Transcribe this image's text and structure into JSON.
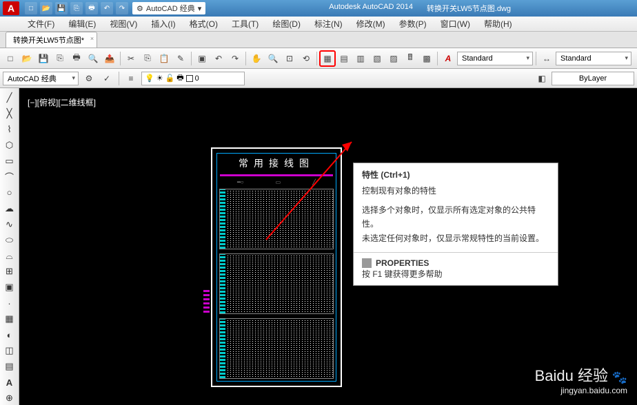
{
  "titlebar": {
    "logo": "A",
    "workspace": "AutoCAD 经典",
    "app_name": "Autodesk AutoCAD 2014",
    "doc_name": "转换开关LW5节点图.dwg"
  },
  "menubar": {
    "file": "文件(F)",
    "edit": "编辑(E)",
    "view": "视图(V)",
    "insert": "插入(I)",
    "format": "格式(O)",
    "tools": "工具(T)",
    "draw": "绘图(D)",
    "dimension": "标注(N)",
    "modify": "修改(M)",
    "param": "参数(P)",
    "window": "窗口(W)",
    "help": "帮助(H)"
  },
  "tab": {
    "name": "转换开关LW5节点图*",
    "close": "×"
  },
  "toolbar1": {
    "style1": "Standard",
    "style2": "Standard"
  },
  "toolbar2": {
    "workspace": "AutoCAD 经典",
    "layer": "0",
    "bylayer": "ByLayer"
  },
  "viewport_label": "[−][俯视][二维线框]",
  "drawing": {
    "title": "常用接线图"
  },
  "tooltip": {
    "title": "特性 (Ctrl+1)",
    "subtitle": "控制现有对象的特性",
    "line1": "选择多个对象时，仅显示所有选定对象的公共特性。",
    "line2": "未选定任何对象时，仅显示常规特性的当前设置。",
    "prop_label": "PROPERTIES",
    "help": "按 F1 键获得更多帮助"
  },
  "watermark": {
    "brand": "Baidu 经验",
    "url": "jingyan.baidu.com"
  }
}
